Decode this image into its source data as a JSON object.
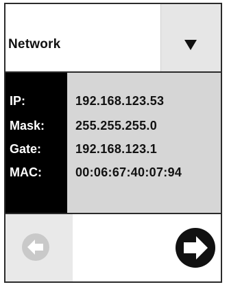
{
  "dropdown": {
    "selected": "Network",
    "arrow_icon": "triangle-down-icon"
  },
  "network": {
    "rows": [
      {
        "label": "IP:",
        "value": "192.168.123.53"
      },
      {
        "label": "Mask:",
        "value": "255.255.255.0"
      },
      {
        "label": "Gate:",
        "value": "192.168.123.1"
      },
      {
        "label": "MAC:",
        "value": "00:06:67:40:07:94"
      }
    ]
  },
  "nav": {
    "back_icon": "arrow-left-icon",
    "back_state": "disabled",
    "next_icon": "arrow-right-icon",
    "next_state": "enabled"
  },
  "colors": {
    "label_panel": "#000000",
    "value_panel": "#d6d6d6",
    "dropdown_button": "#e6e6e6",
    "disabled_icon": "#c9c9c9",
    "active_icon": "#111111"
  }
}
